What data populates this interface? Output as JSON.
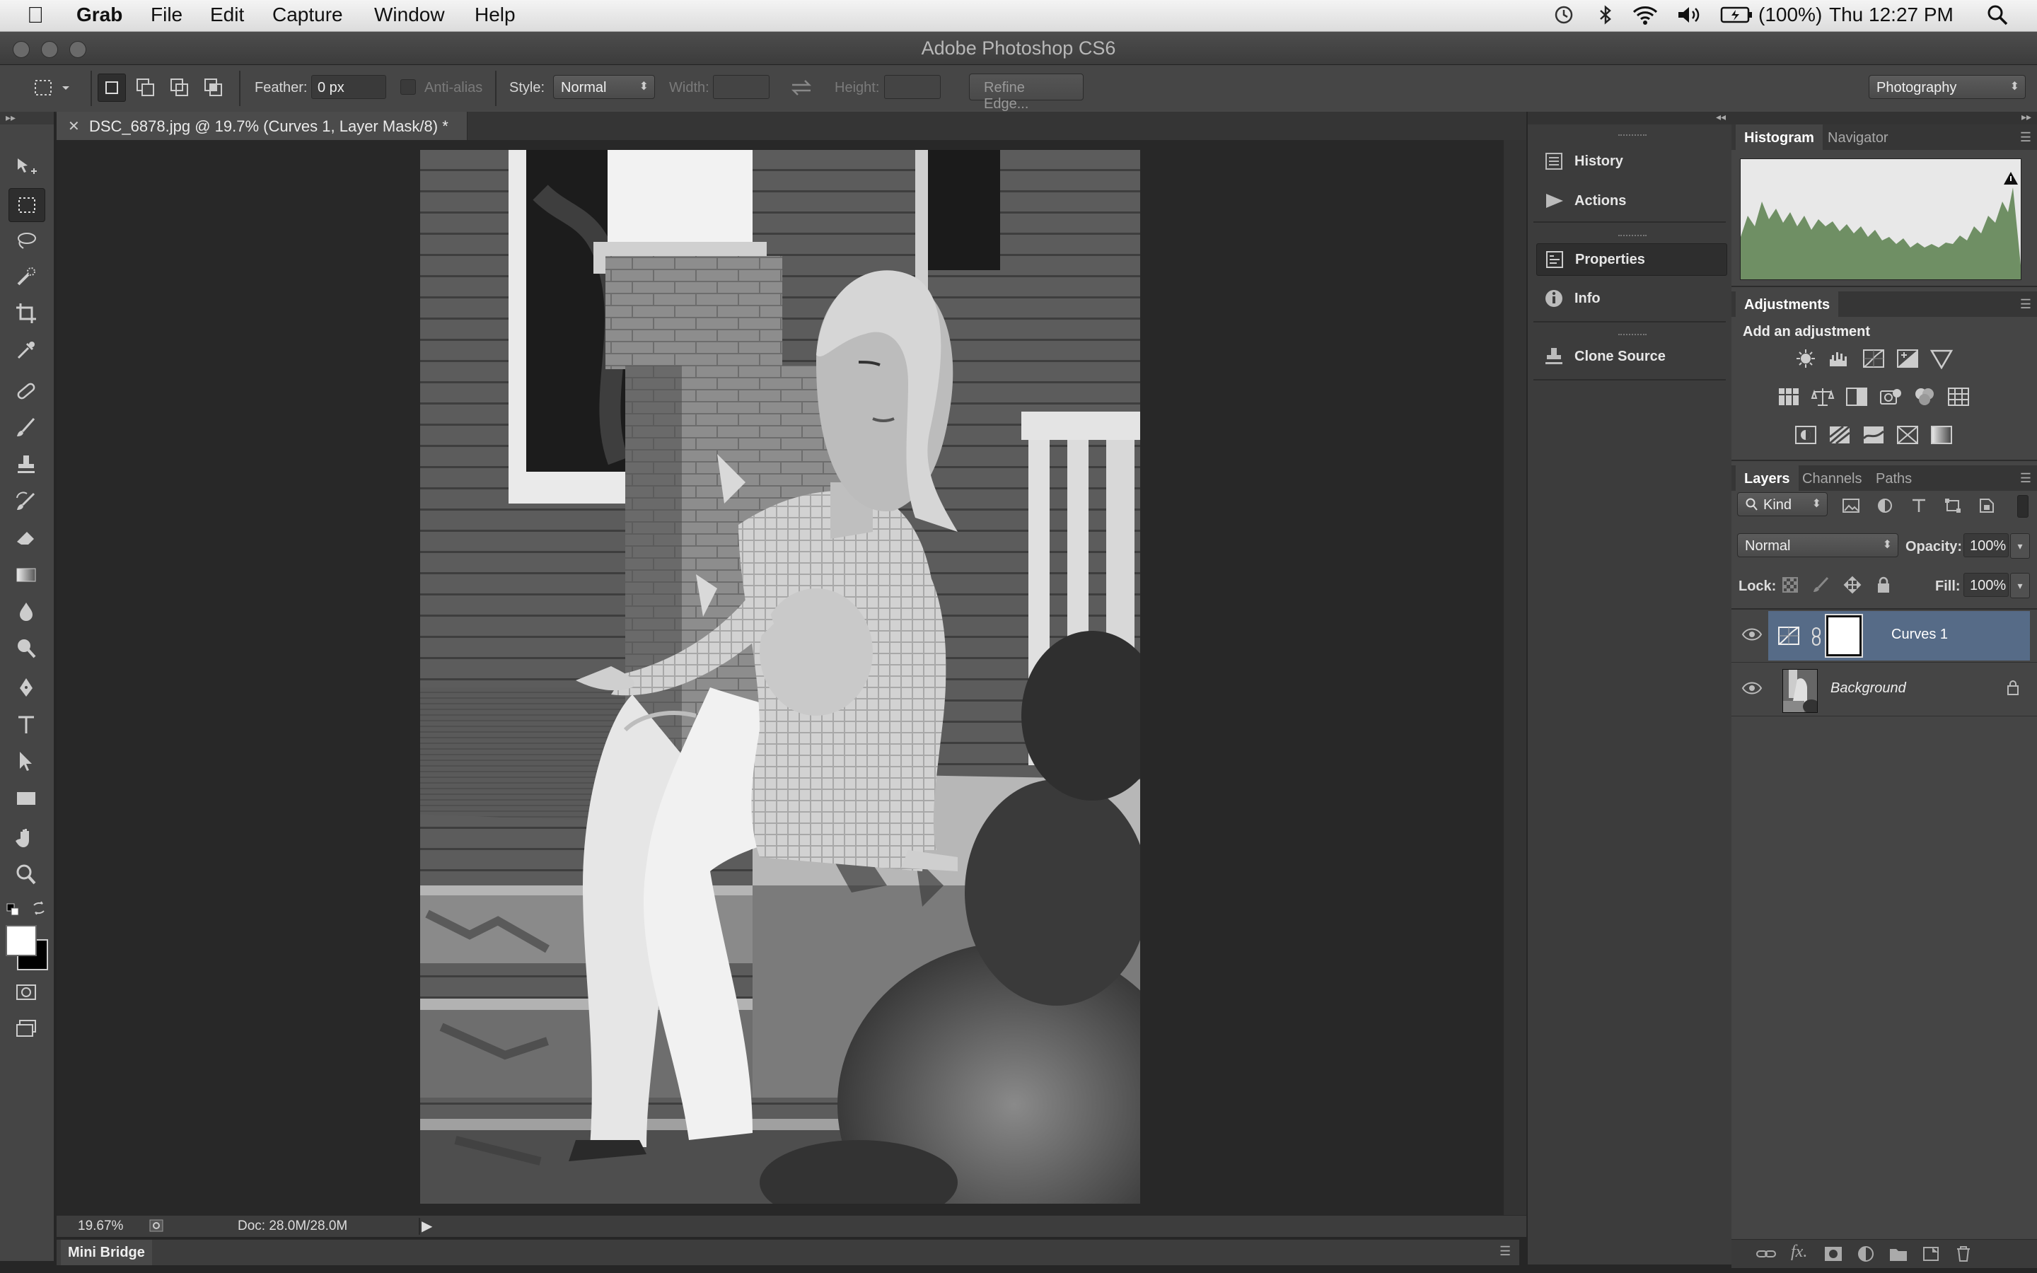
{
  "menubar": {
    "app": "Grab",
    "items": [
      "File",
      "Edit",
      "Capture",
      "Window",
      "Help"
    ],
    "battery": "(100%)",
    "clock": "Thu 12:27 PM"
  },
  "window": {
    "title": "Adobe Photoshop CS6"
  },
  "options": {
    "feather_label": "Feather:",
    "feather_value": "0 px",
    "antialias_label": "Anti-alias",
    "style_label": "Style:",
    "style_value": "Normal",
    "width_label": "Width:",
    "height_label": "Height:",
    "refine_edge": "Refine Edge...",
    "workspace": "Photography"
  },
  "document": {
    "tab_title": "DSC_6878.jpg @ 19.7% (Curves 1, Layer Mask/8) *",
    "zoom": "19.67%",
    "doc_size": "Doc: 28.0M/28.0M"
  },
  "minibridge": {
    "label": "Mini Bridge"
  },
  "dock": {
    "items": [
      "History",
      "Actions",
      "Properties",
      "Info",
      "Clone Source"
    ]
  },
  "histogram": {
    "tabs": [
      "Histogram",
      "Navigator"
    ]
  },
  "adjustments": {
    "tab": "Adjustments",
    "heading": "Add an adjustment"
  },
  "layers": {
    "tabs": [
      "Layers",
      "Channels",
      "Paths"
    ],
    "kind": "Kind",
    "blend_mode": "Normal",
    "opacity_label": "Opacity:",
    "opacity_value": "100%",
    "lock_label": "Lock:",
    "fill_label": "Fill:",
    "fill_value": "100%",
    "rows": [
      {
        "name": "Curves 1",
        "selected": true
      },
      {
        "name": "Background",
        "selected": false
      }
    ]
  },
  "colors": {
    "accent_selected_layer": "#566b87",
    "histogram_fill": "#6f8f64"
  }
}
